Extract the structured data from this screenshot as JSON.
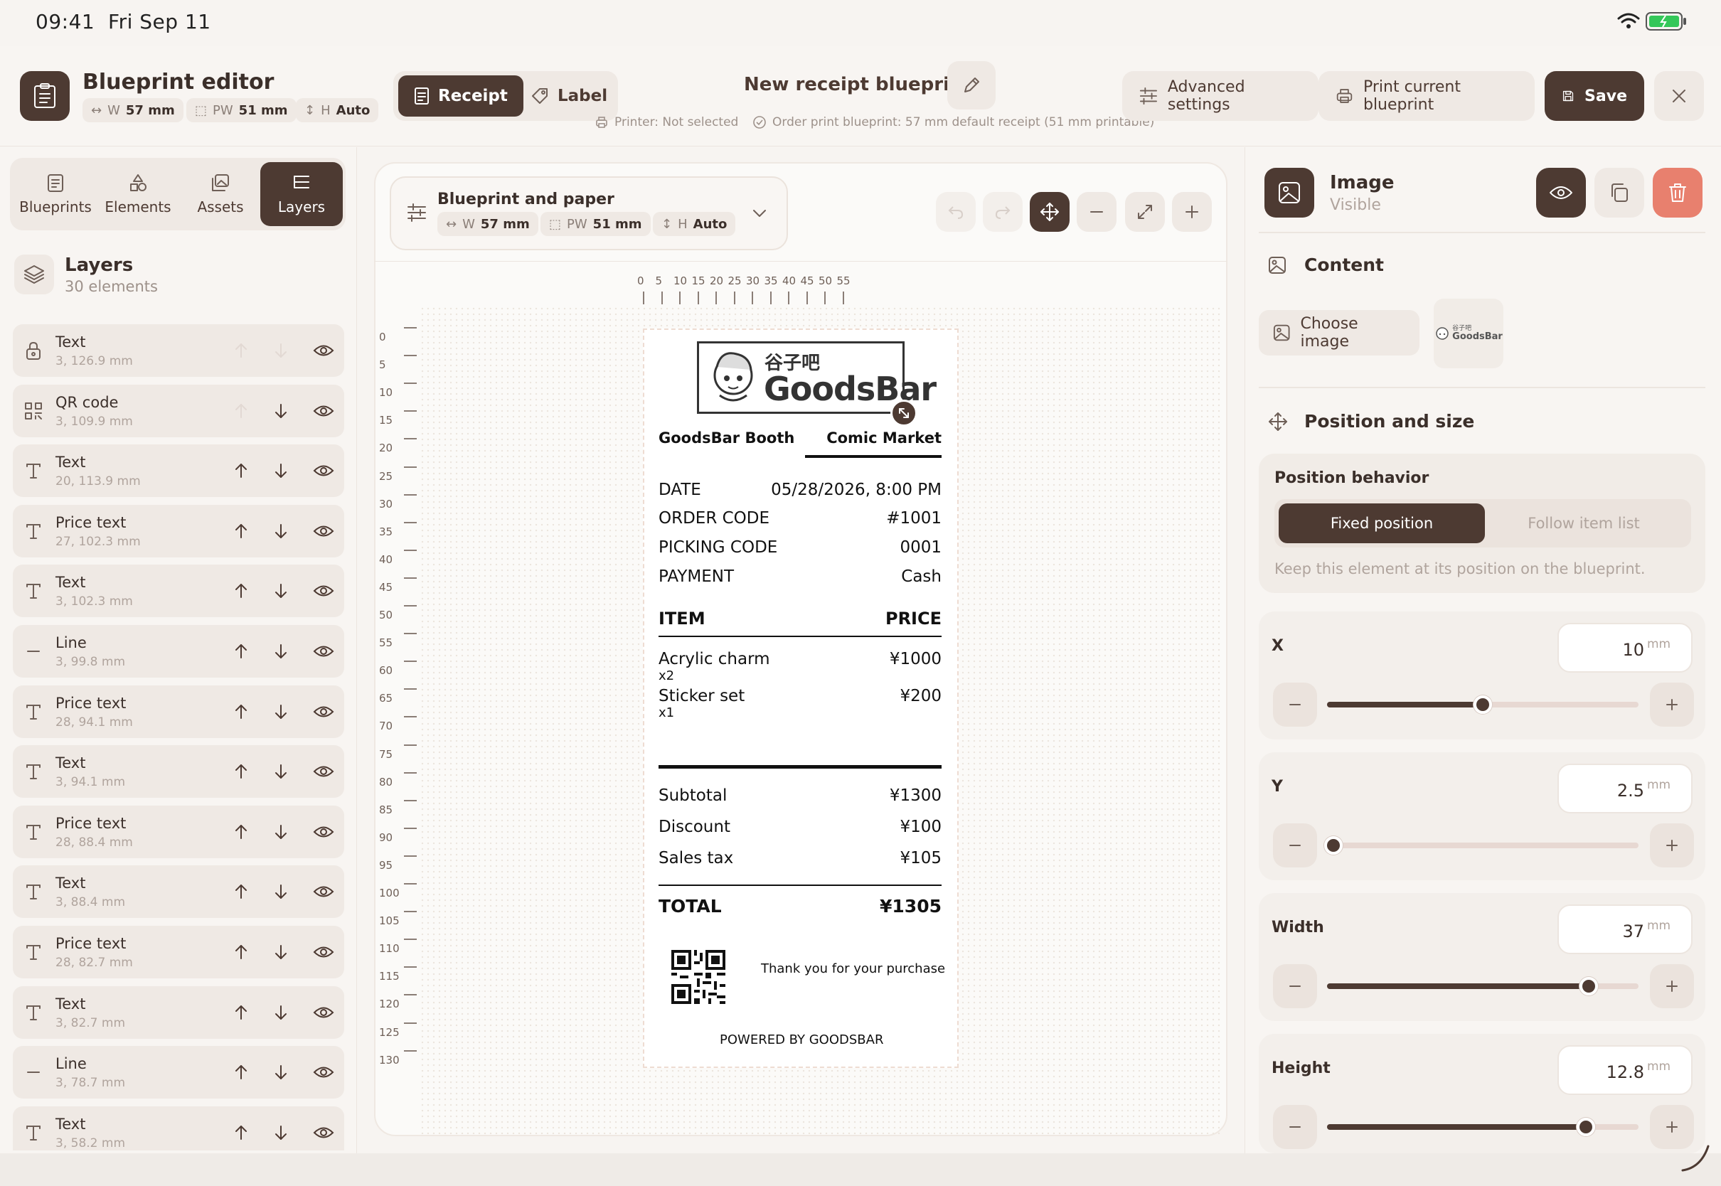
{
  "status_bar": {
    "time": "09:41",
    "date": "Fri Sep 11"
  },
  "header": {
    "app_title": "Blueprint editor",
    "chips": [
      {
        "prefix": "W",
        "value": "57 mm"
      },
      {
        "prefix": "PW",
        "value": "51 mm"
      },
      {
        "prefix": "H",
        "value": "Auto"
      }
    ],
    "mode_tabs": [
      "Receipt",
      "Label"
    ],
    "active_mode": "Receipt",
    "blueprint_name": "New receipt blueprint",
    "printer_status": "Printer: Not selected",
    "order_status": "Order print blueprint: 57 mm default receipt (51 mm printable)",
    "advanced_settings": "Advanced settings",
    "print_current": "Print current blueprint",
    "save": "Save"
  },
  "left_panel": {
    "tabs": [
      "Blueprints",
      "Elements",
      "Assets",
      "Layers"
    ],
    "active_tab": "Layers",
    "layers_title": "Layers",
    "layers_count": "30 elements",
    "layers": [
      {
        "name": "Text",
        "pos": "3, 126.9 mm",
        "icon": "lock-icon"
      },
      {
        "name": "QR code",
        "pos": "3, 109.9 mm",
        "icon": "qr-icon"
      },
      {
        "name": "Text",
        "pos": "20, 113.9 mm",
        "icon": "text-icon"
      },
      {
        "name": "Price text",
        "pos": "27, 102.3 mm",
        "icon": "text-icon"
      },
      {
        "name": "Text",
        "pos": "3, 102.3 mm",
        "icon": "text-icon"
      },
      {
        "name": "Line",
        "pos": "3, 99.8 mm",
        "icon": "line-icon"
      },
      {
        "name": "Price text",
        "pos": "28, 94.1 mm",
        "icon": "text-icon"
      },
      {
        "name": "Text",
        "pos": "3, 94.1 mm",
        "icon": "text-icon"
      },
      {
        "name": "Price text",
        "pos": "28, 88.4 mm",
        "icon": "text-icon"
      },
      {
        "name": "Text",
        "pos": "3, 88.4 mm",
        "icon": "text-icon"
      },
      {
        "name": "Price text",
        "pos": "28, 82.7 mm",
        "icon": "text-icon"
      },
      {
        "name": "Text",
        "pos": "3, 82.7 mm",
        "icon": "text-icon"
      },
      {
        "name": "Line",
        "pos": "3, 78.7 mm",
        "icon": "line-icon"
      },
      {
        "name": "Text",
        "pos": "3, 58.2 mm",
        "icon": "text-icon"
      }
    ]
  },
  "canvas": {
    "paper_title": "Blueprint and paper",
    "paper_chips": [
      {
        "prefix": "W",
        "value": "57 mm"
      },
      {
        "prefix": "PW",
        "value": "51 mm"
      },
      {
        "prefix": "H",
        "value": "Auto"
      }
    ],
    "ruler_h": [
      "0",
      "5",
      "10",
      "15",
      "20",
      "25",
      "30",
      "35",
      "40",
      "45",
      "50",
      "55"
    ],
    "ruler_v": [
      "0",
      "5",
      "10",
      "15",
      "20",
      "25",
      "30",
      "35",
      "40",
      "45",
      "50",
      "55",
      "60",
      "65",
      "70",
      "75",
      "80",
      "85",
      "90",
      "95",
      "100",
      "105",
      "110",
      "115",
      "120",
      "125",
      "130"
    ]
  },
  "receipt": {
    "logo_cn": "谷子吧",
    "logo_en": "GoodsBar",
    "booth": "GoodsBar Booth",
    "event": "Comic Market",
    "info": [
      {
        "label": "DATE",
        "value": "05/28/2026, 8:00 PM"
      },
      {
        "label": "ORDER CODE",
        "value": "#1001"
      },
      {
        "label": "PICKING CODE",
        "value": "0001"
      },
      {
        "label": "PAYMENT",
        "value": "Cash"
      }
    ],
    "item_header": "ITEM",
    "price_header": "PRICE",
    "items": [
      {
        "name": "Acrylic charm",
        "qty": "x2",
        "price": "¥1000"
      },
      {
        "name": "Sticker set",
        "qty": "x1",
        "price": "¥200"
      }
    ],
    "totals": [
      {
        "label": "Subtotal",
        "value": "¥1300"
      },
      {
        "label": "Discount",
        "value": "¥100"
      },
      {
        "label": "Sales tax",
        "value": "¥105"
      }
    ],
    "total_label": "TOTAL",
    "total_value": "¥1305",
    "thank_you": "Thank you for your purchase",
    "powered": "POWERED BY GOODSBAR"
  },
  "right_panel": {
    "element_title": "Image",
    "element_status": "Visible",
    "content_title": "Content",
    "choose_image": "Choose image",
    "thumb_cn": "谷子吧",
    "thumb_en": "GoodsBar",
    "position_title": "Position and size",
    "position_behavior_title": "Position behavior",
    "behavior_options": [
      "Fixed position",
      "Follow item list"
    ],
    "active_behavior": "Fixed position",
    "behavior_desc": "Keep this element at its position on the blueprint.",
    "fields": [
      {
        "label": "X",
        "value": "10",
        "unit": "mm",
        "slider_fraction": 0.5
      },
      {
        "label": "Y",
        "value": "2.5",
        "unit": "mm",
        "slider_fraction": 0.02
      },
      {
        "label": "Width",
        "value": "37",
        "unit": "mm",
        "slider_fraction": 0.84
      },
      {
        "label": "Height",
        "value": "12.8",
        "unit": "mm",
        "slider_fraction": 0.83
      }
    ]
  },
  "colors": {
    "accent": "#4d3a32",
    "danger": "#e8806e",
    "background": "#f7f4f1"
  }
}
